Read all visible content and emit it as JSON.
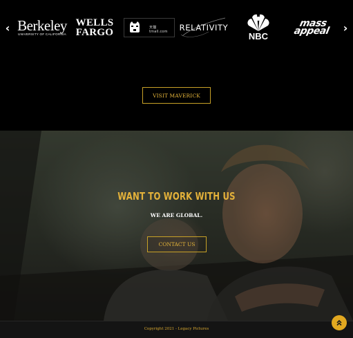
{
  "carousel": {
    "prev_icon": "chevron-left-icon",
    "next_icon": "chevron-right-icon",
    "prev_glyph": "‹",
    "next_glyph": "›",
    "logos": {
      "berkeley": {
        "main": "Berkeley",
        "sub": "UNIVERSITY OF CALIFORNIA"
      },
      "wells_fargo": {
        "line1": "WELLS",
        "line2": "FARGO"
      },
      "tmall": {
        "text": "天猫 tmall.com"
      },
      "relativity": {
        "text": "RELATIVITY"
      },
      "nbc": {
        "text": "NBC"
      },
      "mass_appeal": {
        "line1": "mass",
        "line2": "appeal"
      }
    }
  },
  "visit_button": {
    "label": "VISIT MAVERICK"
  },
  "hero": {
    "title": "WANT TO WORK WITH US",
    "subtitle": "WE ARE GLOBAL.",
    "contact_label": "CONTACT US"
  },
  "footer": {
    "copyright": "Copyright 2021 - Legacy Pictures",
    "scroll_top_icon": "double-chevron-up-icon",
    "scroll_top_glyph": "»"
  },
  "colors": {
    "accent": "#e5b53a",
    "background": "#000000",
    "footer_bg": "#141414",
    "scroll_button": "#e2a820"
  }
}
